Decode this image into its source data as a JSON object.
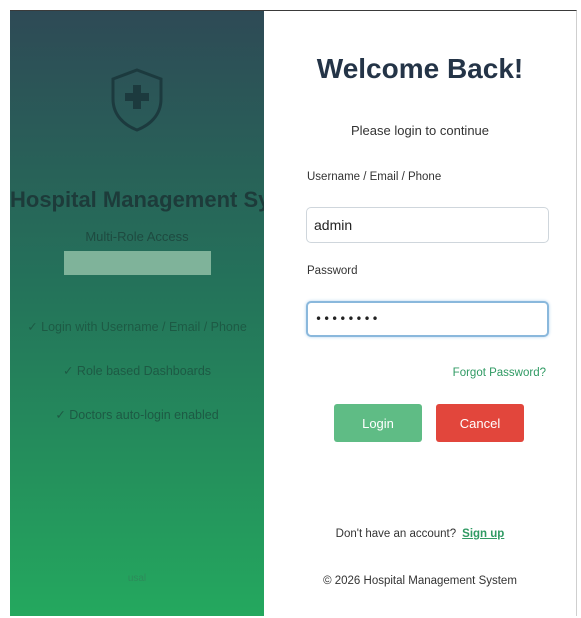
{
  "branding": {
    "title": "Hospital Management Sy...",
    "subtitle": "Multi-Role Access",
    "icon": "shield-plus-icon",
    "features": [
      "✓ Login with Username / Email / Phone",
      "✓ Role based Dashboards",
      "✓ Doctors auto-login enabled"
    ],
    "footer_text": "usal"
  },
  "login": {
    "heading": "Welcome Back!",
    "subtitle": "Please login to continue",
    "username_label": "Username / Email / Phone",
    "username_value": "admin",
    "password_label": "Password",
    "password_value": "••••••••",
    "forgot_link": "Forgot Password?",
    "login_button": "Login",
    "cancel_button": "Cancel",
    "signup_prompt": "Don't have an account?",
    "signup_link": "Sign up",
    "footer": "© 2026 Hospital Management System"
  },
  "colors": {
    "accent_green": "#2f9a63",
    "login_button": "#5fbc85",
    "cancel_button": "#e2463c",
    "heading": "#243447"
  }
}
